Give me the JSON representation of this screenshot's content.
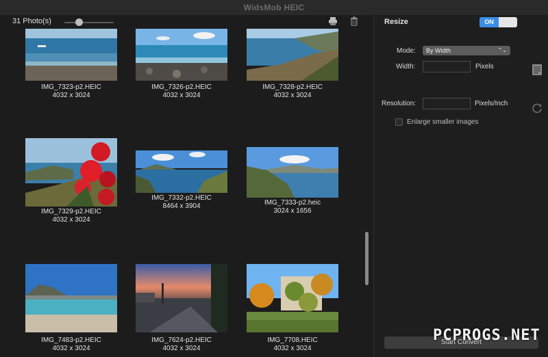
{
  "window": {
    "title": "WidsMob HEIC"
  },
  "toolbar": {
    "photo_count": "31 Photo(s)",
    "zoom_level": 0.3
  },
  "photos": [
    {
      "name": "IMG_7323-p2.HEIC",
      "dims": "4032 x 3024"
    },
    {
      "name": "IMG_7326-p2.HEIC",
      "dims": "4032 x 3024"
    },
    {
      "name": "IMG_7328-p2.HEIC",
      "dims": "4032 x 3024"
    },
    {
      "name": "IMG_7329-p2.HEIC",
      "dims": "4032 x 3024"
    },
    {
      "name": "IMG_7332-p2.HEIC",
      "dims": "8464 x 3904"
    },
    {
      "name": "IMG_7333-p2.heic",
      "dims": "3024 x 1656"
    },
    {
      "name": "IMG_7483-p2.HEIC",
      "dims": "4032 x 3024"
    },
    {
      "name": "IMG_7624-p2.HEIC",
      "dims": "4032 x 3024"
    },
    {
      "name": "IMG_7708.HEIC",
      "dims": "4032 x 3024"
    }
  ],
  "resize": {
    "title": "Resize",
    "toggle_label": "ON",
    "mode_label": "Mode:",
    "mode_value": "By Width",
    "width_label": "Width:",
    "width_value": "",
    "width_unit": "Pixels",
    "resolution_label": "Resolution:",
    "resolution_value": "",
    "resolution_unit": "Pixels/Inch",
    "enlarge_label": "Enlarge smaller images",
    "start_label": "Start Convert"
  },
  "watermark": "PCPROGS.NET",
  "colors": {
    "accent": "#3a8ee6",
    "background": "#1e1e1e"
  }
}
